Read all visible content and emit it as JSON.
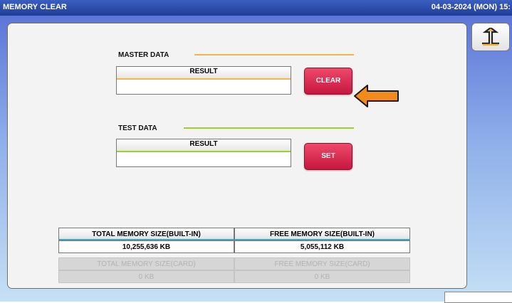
{
  "window": {
    "title": "MEMORY CLEAR",
    "datetime": "04-03-2024 (MON) 15:"
  },
  "back_button": {
    "icon": "return-arrow-icon"
  },
  "master": {
    "label": "MASTER DATA",
    "result_header": "RESULT",
    "result_value": "",
    "button_label": "CLEAR",
    "accent_color": "#f0b64a"
  },
  "test": {
    "label": "TEST DATA",
    "result_header": "RESULT",
    "result_value": "",
    "button_label": "SET",
    "accent_color": "#9ccf2f"
  },
  "memory": {
    "builtin": {
      "total_label": "TOTAL MEMORY SIZE(BUILT-IN)",
      "free_label": "FREE MEMORY SIZE(BUILT-IN)",
      "total_value": "10,255,636 KB",
      "free_value": "5,055,112 KB"
    },
    "card": {
      "total_label": "TOTAL MEMORY SIZE(CARD)",
      "free_label": "FREE MEMORY SIZE(CARD)",
      "total_value": "0 KB",
      "free_value": "0 KB"
    }
  },
  "colors": {
    "arrow": "#f28a1c",
    "button_red": "#d72048",
    "memory_divider": "#3aa6c7"
  }
}
